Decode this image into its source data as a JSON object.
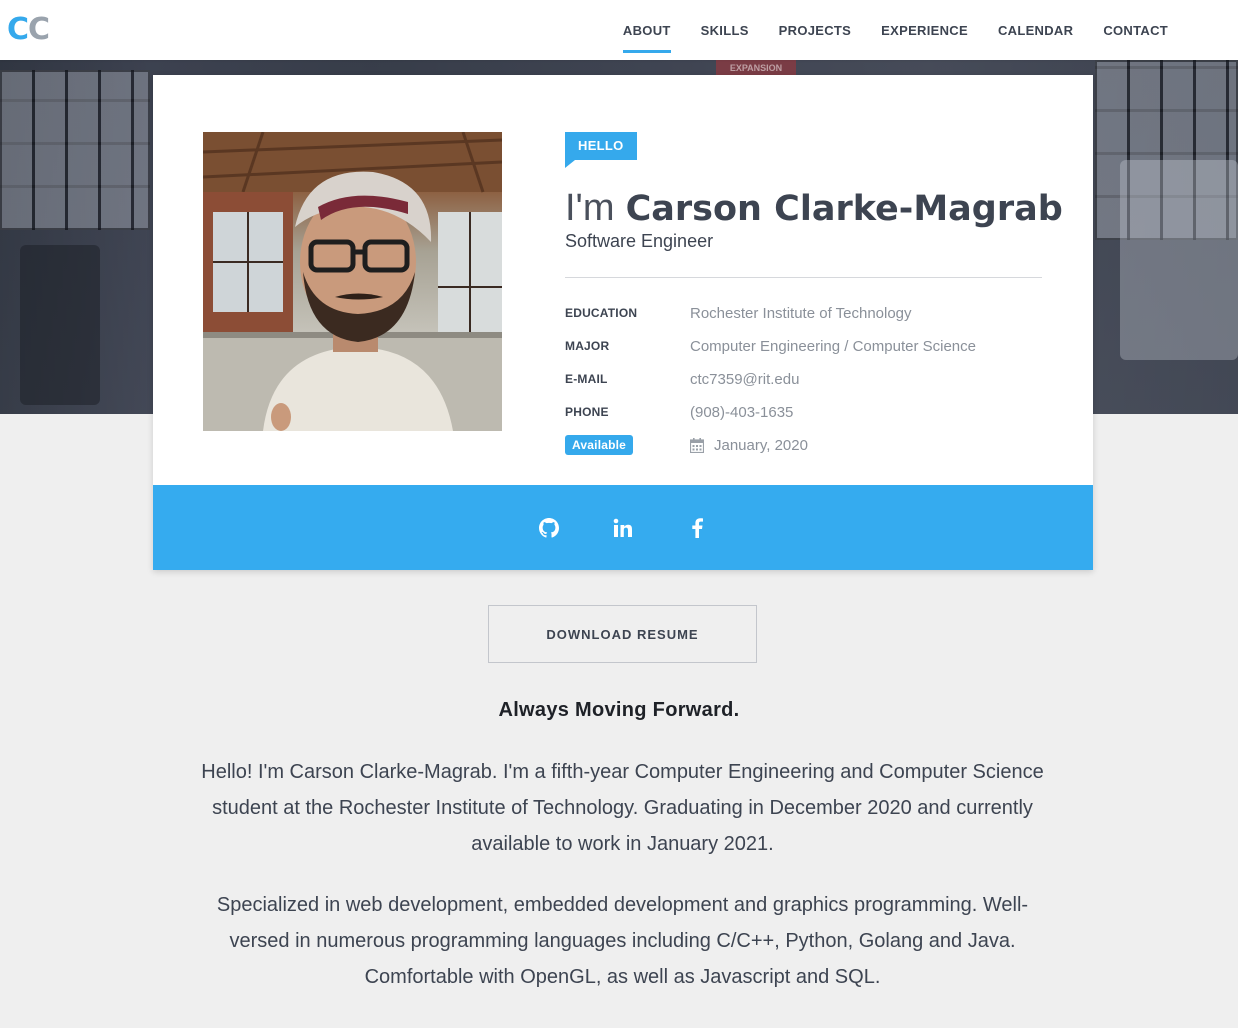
{
  "nav": {
    "logo_first": "C",
    "logo_second": "C",
    "links": [
      "ABOUT",
      "SKILLS",
      "PROJECTS",
      "EXPERIENCE",
      "CALENDAR",
      "CONTACT"
    ],
    "active": "ABOUT"
  },
  "hero": {
    "sign_text": "EXPANSION"
  },
  "profile": {
    "badge": "HELLO",
    "greeting": "I'm",
    "name": "Carson Clarke-Magrab",
    "title": "Software Engineer",
    "info": [
      {
        "label": "EDUCATION",
        "value": "Rochester Institute of Technology"
      },
      {
        "label": "MAJOR",
        "value": "Computer Engineering / Computer Science"
      },
      {
        "label": "E-MAIL",
        "value": "ctc7359@rit.edu"
      },
      {
        "label": "PHONE",
        "value": "(908)-403-1635"
      }
    ],
    "availability_badge": "Available",
    "availability_date": "January, 2020",
    "availability_icon": "calendar-icon"
  },
  "social": {
    "icons": [
      "github-icon",
      "linkedin-icon",
      "facebook-icon"
    ]
  },
  "resume_button": "DOWNLOAD RESUME",
  "motto": "Always Moving Forward.",
  "paragraphs": [
    "Hello! I'm Carson Clarke-Magrab. I'm a fifth-year Computer Engineering and Computer Science student at the Rochester Institute of Technology. Graduating in December 2020 and currently available to work in January 2021.",
    "Specialized in web development, embedded development and graphics programming. Well-versed in numerous programming languages including C/C++, Python, Golang and Java. Comfortable with OpenGL, as well as Javascript and SQL."
  ],
  "colors": {
    "accent": "#35a9ec",
    "text": "#3d4451",
    "muted": "#8a9099",
    "background": "#efefef"
  }
}
